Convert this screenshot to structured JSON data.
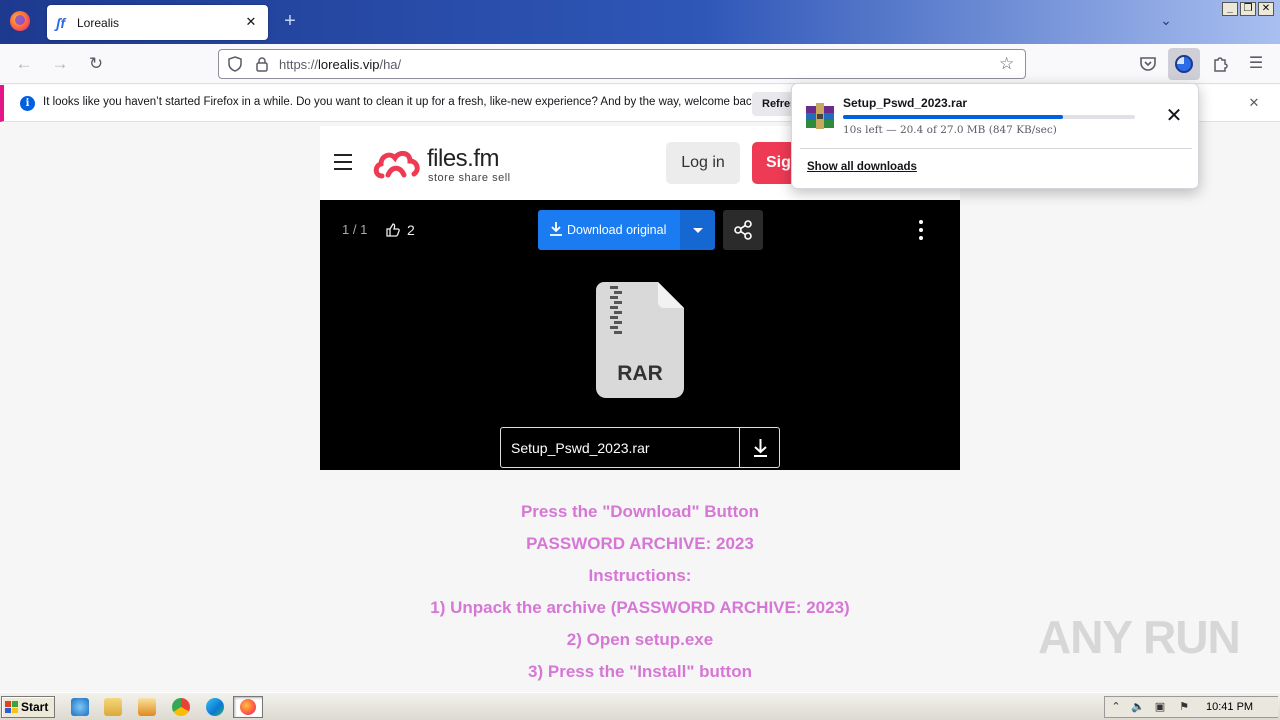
{
  "browser": {
    "tab_title": "Lorealis",
    "url_prefix": "https://",
    "url_host": "lorealis.vip",
    "url_path": "/ha/"
  },
  "notification": {
    "message": "It looks like you haven’t started Firefox in a while. Do you want to clean it up for a fresh, like-new experience? And by the way, welcome back!",
    "refresh_label": "Refresh Firefox"
  },
  "downloads_panel": {
    "filename": "Setup_Pswd_2023.rar",
    "status": "10s left — 20.4 of 27.0 MB (847 KB/sec)",
    "progress_fraction": 0.755,
    "show_all_label": "Show all downloads"
  },
  "site": {
    "logo_word": "files.fm",
    "logo_tagline": "store  share  sell",
    "login_label": "Log in",
    "signup_label": "Sign up",
    "brand_color": "#ee3a54",
    "accent_color": "#1a7cf0"
  },
  "viewer": {
    "counter": "1 / 1",
    "likes": "2",
    "download_label": "Download original",
    "file_type": "RAR",
    "filename": "Setup_Pswd_2023.rar"
  },
  "instructions": [
    "Press the \"Download\" Button",
    "PASSWORD ARCHIVE: 2023",
    "Instructions:",
    "1) Unpack the archive (PASSWORD ARCHIVE: 2023)",
    "2) Open setup.exe",
    "3) Press the \"Install\" button"
  ],
  "instructions_color": "#d677d6",
  "watermark": "ANY RUN",
  "taskbar": {
    "start_label": "Start",
    "clock": "10:41 PM"
  },
  "icons": {
    "toolbar": [
      "back-arrow-icon",
      "forward-arrow-icon",
      "reload-icon",
      "shield-icon",
      "lock-icon",
      "star-icon",
      "pocket-icon",
      "download-icon",
      "extensions-icon",
      "menu-icon"
    ]
  }
}
